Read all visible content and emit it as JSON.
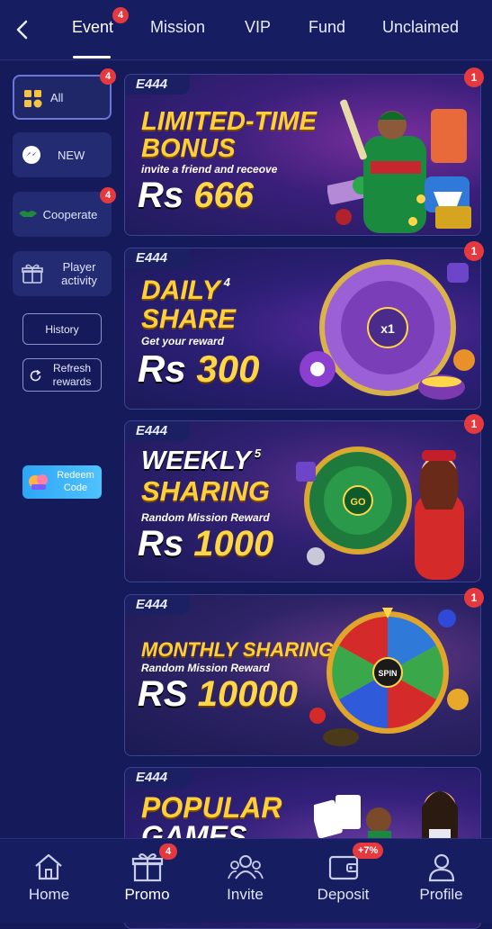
{
  "header": {
    "tabs": [
      {
        "label": "Event",
        "badge": "4",
        "active": true
      },
      {
        "label": "Mission"
      },
      {
        "label": "VIP"
      },
      {
        "label": "Fund"
      },
      {
        "label": "Unclaimed"
      }
    ]
  },
  "sidebar": {
    "items": [
      {
        "label": "All",
        "badge": "4",
        "active": true
      },
      {
        "label": "NEW"
      },
      {
        "label": "Cooperate",
        "badge": "4"
      },
      {
        "label": "Player activity"
      }
    ],
    "history_label": "History",
    "refresh_label": "Refresh rewards",
    "redeem_label": "Redeem Code"
  },
  "cards": [
    {
      "logo": "E444",
      "title1": "LIMITED-TIME",
      "title2": "BONUS",
      "subtitle": "invite a friend and receove",
      "currency": "Rs",
      "amount": "666",
      "badge": "1"
    },
    {
      "logo": "E444",
      "title1": "DAILY",
      "title1_mark": "4",
      "title2": "SHARE",
      "subtitle": "Get your reward",
      "currency": "Rs",
      "amount": "300",
      "badge": "1"
    },
    {
      "logo": "E444",
      "title1": "WEEKLY",
      "title1_mark": "5",
      "title2": "SHARING",
      "subtitle": "Random Mission Reward",
      "currency": "Rs",
      "amount": "1000",
      "badge": "1"
    },
    {
      "logo": "E444",
      "title1": "MONTHLY SHARING",
      "subtitle": "Random Mission Reward",
      "currency": "RS",
      "amount": "10000",
      "badge": "1"
    },
    {
      "logo": "E444",
      "title1": "POPULAR",
      "title2": "GAMES"
    }
  ],
  "bottom_nav": {
    "items": [
      {
        "label": "Home"
      },
      {
        "label": "Promo",
        "badge": "4",
        "active": true
      },
      {
        "label": "Invite"
      },
      {
        "label": "Deposit",
        "badge": "+7%"
      },
      {
        "label": "Profile"
      }
    ]
  },
  "colors": {
    "background": "#141a5a",
    "badge": "#e43a3f",
    "gold": "#ffcf3a",
    "accent_blue": "#2ea6f5"
  }
}
